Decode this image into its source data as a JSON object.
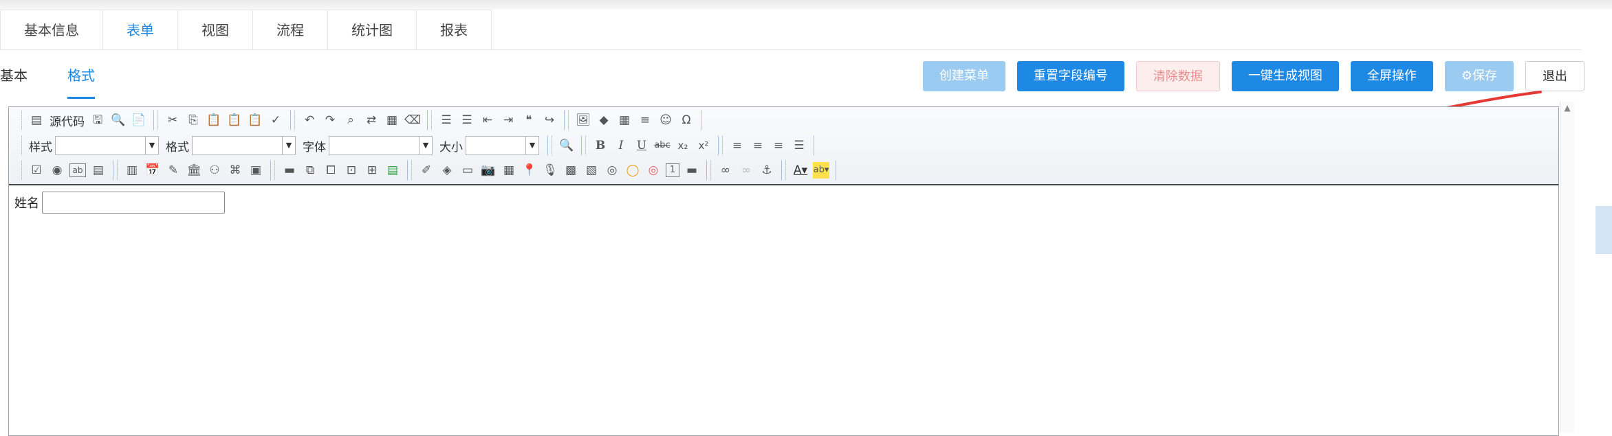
{
  "main_tabs": [
    {
      "label": "基本信息",
      "active": false
    },
    {
      "label": "表单",
      "active": true
    },
    {
      "label": "视图",
      "active": false
    },
    {
      "label": "流程",
      "active": false
    },
    {
      "label": "统计图",
      "active": false
    },
    {
      "label": "报表",
      "active": false
    }
  ],
  "sub_tabs": [
    {
      "label": "基本",
      "active": false
    },
    {
      "label": "格式",
      "active": true
    }
  ],
  "actions": [
    {
      "label": "创建菜单",
      "style": "light"
    },
    {
      "label": "重置字段编号",
      "style": "primary"
    },
    {
      "label": "清除数据",
      "style": "danger"
    },
    {
      "label": "一键生成视图",
      "style": "primary"
    },
    {
      "label": "全屏操作",
      "style": "primary"
    },
    {
      "label": "⚙保存",
      "style": "light"
    },
    {
      "label": "退出",
      "style": "default"
    }
  ],
  "toolbar": {
    "source_label": "源代码",
    "style_label": "样式",
    "format_label": "格式",
    "font_label": "字体",
    "size_label": "大小",
    "bold": "B",
    "italic": "I",
    "underline": "U",
    "strike": "abc",
    "subscript": "x₂",
    "superscript": "x²"
  },
  "form": {
    "name_label": "姓名",
    "name_value": ""
  },
  "colors": {
    "primary": "#1e88e5",
    "light": "#9ccbf2",
    "danger_text": "#e88e8e",
    "annotation": "#e53935"
  }
}
